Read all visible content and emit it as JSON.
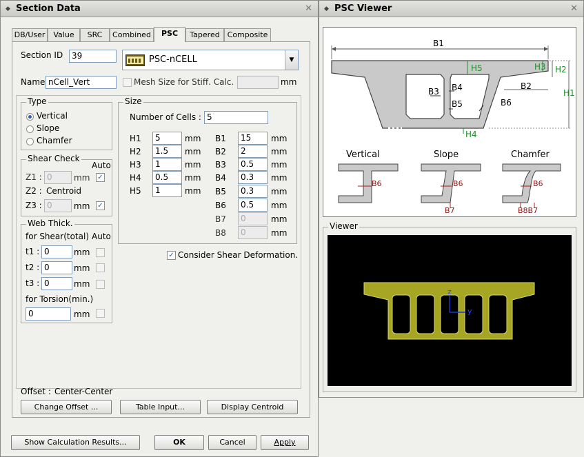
{
  "section_window": {
    "title": "Section Data",
    "tabs": [
      "DB/User",
      "Value",
      "SRC",
      "Combined",
      "PSC",
      "Tapered",
      "Composite"
    ],
    "active_tab": "PSC",
    "section_id_label": "Section ID",
    "section_id": "39",
    "section_type": "PSC-nCELL",
    "name_label": "Name",
    "name": "nCell_Vert",
    "mesh_label": "Mesh Size for Stiff. Calc.",
    "mesh_unit": "mm",
    "type_group": {
      "title": "Type",
      "options": [
        "Vertical",
        "Slope",
        "Chamfer"
      ],
      "selected": "Vertical"
    },
    "shear_group": {
      "title": "Shear Check",
      "auto_label": "Auto",
      "z1_label": "Z1 :",
      "z1_value": "0",
      "z2_label": "Z2 :",
      "z2_value": "Centroid",
      "z3_label": "Z3 :",
      "z3_value": "0",
      "unit": "mm"
    },
    "web_group": {
      "title": "Web Thick.",
      "shear_label": "for Shear(total)",
      "auto_label": "Auto",
      "t1_label": "t1 :",
      "t1": "0",
      "t2_label": "t2 :",
      "t2": "0",
      "t3_label": "t3 :",
      "t3": "0",
      "torsion_label": "for Torsion(min.)",
      "torsion": "0",
      "unit": "mm"
    },
    "size_group": {
      "title": "Size",
      "cells_label": "Number of Cells :",
      "cells": "5",
      "unit": "mm",
      "h_labels": [
        "H1",
        "H2",
        "H3",
        "H4",
        "H5"
      ],
      "h_values": [
        "5",
        "1.5",
        "1",
        "0.5",
        "1"
      ],
      "b_labels": [
        "B1",
        "B2",
        "B3",
        "B4",
        "B5",
        "B6",
        "B7",
        "B8"
      ],
      "b_values": [
        "15",
        "2",
        "0.5",
        "0.3",
        "0.3",
        "0.5",
        "0",
        "0"
      ]
    },
    "consider_shear_label": "Consider Shear Deformation.",
    "offset_label": "Offset :",
    "offset_value": "Center-Center",
    "buttons": {
      "change_offset": "Change Offset ...",
      "table_input": "Table Input...",
      "display_centroid": "Display Centroid",
      "show_results": "Show Calculation Results...",
      "ok": "OK",
      "cancel": "Cancel",
      "apply": "Apply"
    }
  },
  "viewer_window": {
    "title": "PSC Viewer",
    "sketch_labels": {
      "B1": "B1",
      "B2": "B2",
      "B3": "B3",
      "B4": "B4",
      "B5": "B5",
      "B6": "B6",
      "H1": "H1",
      "H2": "H2",
      "H3": "H3",
      "H4": "H4",
      "H5": "H5"
    },
    "types": [
      "Vertical",
      "Slope",
      "Chamfer"
    ],
    "detail_labels": {
      "b6": "B6",
      "b7": "B7",
      "b8b7": "B8B7"
    },
    "viewer_label": "Viewer",
    "axis_z": "z",
    "axis_y": "y",
    "colors": {
      "section_fill": "#a6a624",
      "viewer_bg": "#000000",
      "axis": "#1b33d8",
      "dim_green": "#1f8f2a",
      "dim_red": "#b11818"
    }
  }
}
